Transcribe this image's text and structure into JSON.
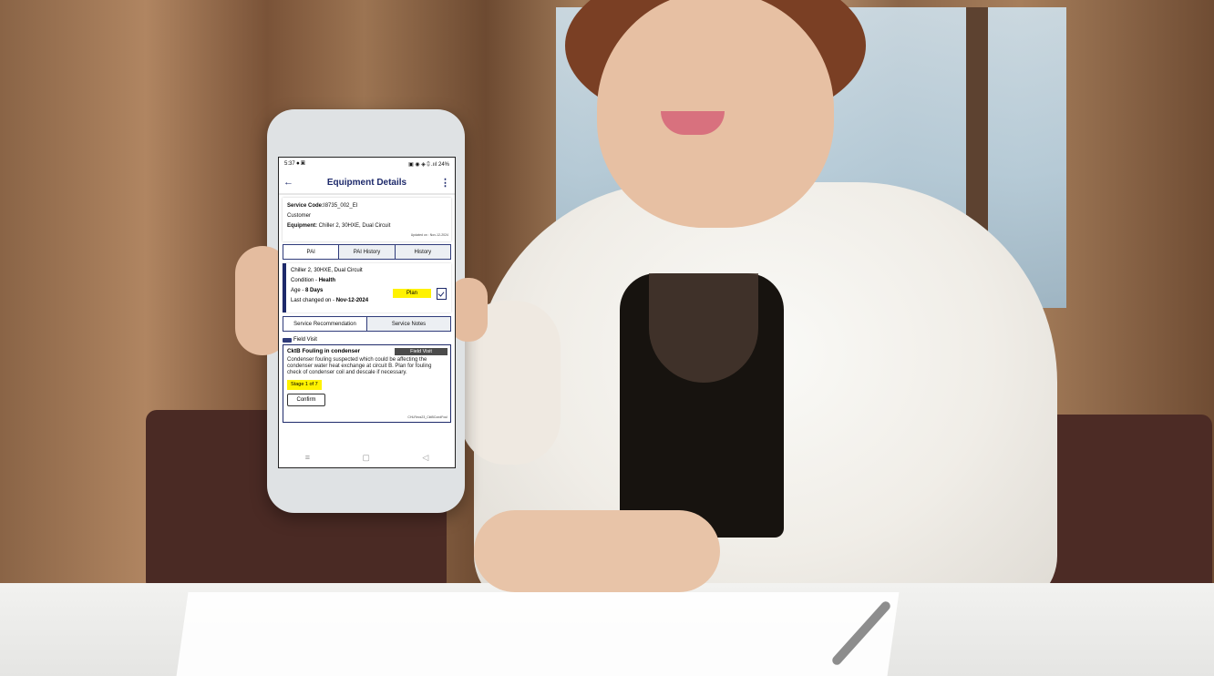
{
  "status_bar": {
    "time": "5:37",
    "left_icons": "⏺ ▣",
    "right_icons": "▣ ◉ ◈ ⩇ .ııl",
    "battery": "24%"
  },
  "app_bar": {
    "title": "Equipment Details",
    "back_icon": "back-arrow-icon",
    "menu_icon": "more-vert-icon"
  },
  "summary": {
    "service_code_label": "Service Code:",
    "service_code_value": "I8735_002_EI",
    "customer": "Customer",
    "equipment_label": "Equipment:",
    "equipment_value": " Chiller 2, 30HXE, Dual Circuit",
    "updated": "Updated on : Nov-12-2024"
  },
  "tabs": [
    {
      "label": "PAI",
      "active": true
    },
    {
      "label": "PAI History",
      "active": false
    },
    {
      "label": "History",
      "active": false
    }
  ],
  "card": {
    "name": "Chiller 2, 30HXE, Dual Circuit",
    "condition_label": "Condition - ",
    "condition_value": "Health",
    "age_label": "Age - ",
    "age_value": "8 Days",
    "changed_label": "Last changed on - ",
    "changed_value": "Nov-12-2024",
    "plan_label": "Plan"
  },
  "subtabs": [
    {
      "label": "Service Recommendation",
      "active": true
    },
    {
      "label": "Service Notes",
      "active": false
    }
  ],
  "section_label": "Field Visit",
  "recommendation": {
    "title": "CktB Fouling in condenser",
    "badge": "Field Visit",
    "description": "Condenser fouling suspected which could be affecting the condenser water heat exchange at circuit B. Plan for fouling check of condenser coil and descale if necessary.",
    "stage": "Stage 1 of 7",
    "confirm_label": "Confirm",
    "code": "CHLRecs23_CktBCondFoul"
  },
  "nav_bar": {
    "menu": "≡",
    "home": "▢",
    "back": "◁"
  }
}
